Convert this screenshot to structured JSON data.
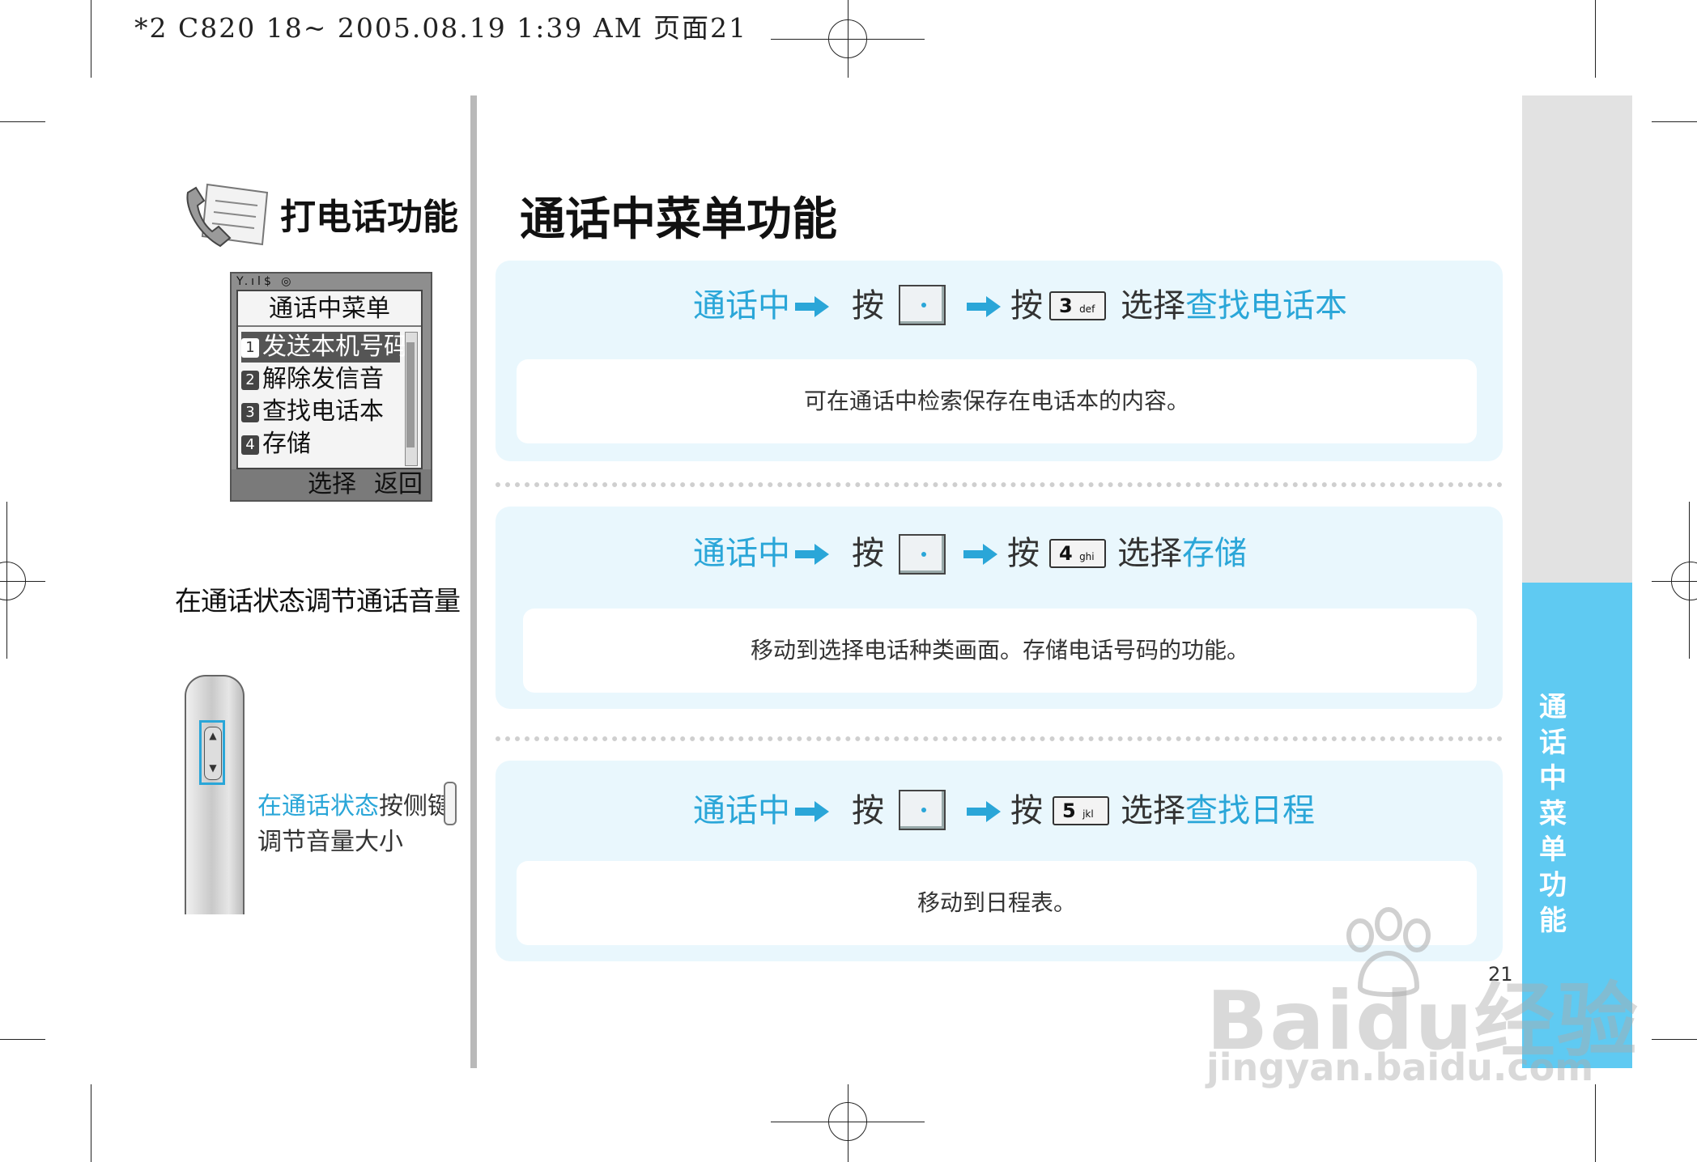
{
  "print_header": "*2 C820 18~  2005.08.19 1:39 AM  页面21",
  "left": {
    "title": "打电话功能",
    "screen": {
      "status": "Y.ıl$ ◎",
      "title": "通话中菜单",
      "items": [
        {
          "num": "1",
          "label": "发送本机号码"
        },
        {
          "num": "2",
          "label": "解除发信音"
        },
        {
          "num": "3",
          "label": "查找电话本"
        },
        {
          "num": "4",
          "label": "存储"
        }
      ],
      "softkey_select": "选择",
      "softkey_back": "返回"
    },
    "volume_heading": "在通话状态调节通话音量",
    "volume_desc_highlight": "在通话状态",
    "volume_desc_rest": "按侧键调节音量大小"
  },
  "main": {
    "title": "通话中菜单功能",
    "steps": [
      {
        "state": "通话中",
        "press1": "按",
        "press2": "按",
        "key_num": "3",
        "key_sub": "def",
        "select_word": "选择",
        "select_target": "查找电话本",
        "description": "可在通话中检索保存在电话本的内容。"
      },
      {
        "state": "通话中",
        "press1": "按",
        "press2": "按",
        "key_num": "4",
        "key_sub": "ghi",
        "select_word": "选择",
        "select_target": "存储",
        "description": "移动到选择电话种类画面。存储电话号码的功能。"
      },
      {
        "state": "通话中",
        "press1": "按",
        "press2": "按",
        "key_num": "5",
        "key_sub": "jkl",
        "select_word": "选择",
        "select_target": "查找日程",
        "description": "移动到日程表。"
      }
    ]
  },
  "side_tab": {
    "label": "通话中菜单功能"
  },
  "page_number": "21",
  "watermark": {
    "brand": "Baidu经验",
    "url": "jingyan.baidu.com"
  },
  "colors": {
    "accent": "#2aa6d8",
    "card_bg": "#e9f7fd",
    "tab_blue": "#5fcaf2",
    "tab_gray": "#e2e2e2"
  }
}
